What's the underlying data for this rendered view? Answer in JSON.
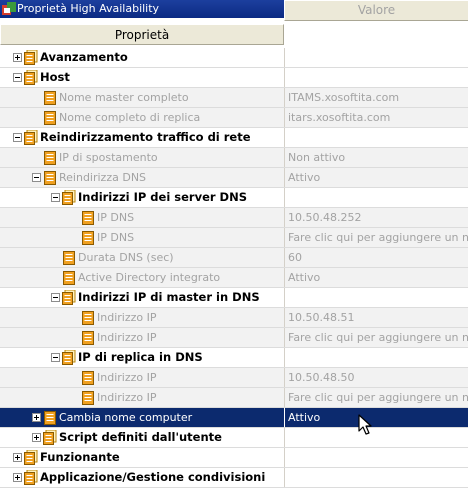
{
  "window": {
    "title": "Proprietà High Availability"
  },
  "columns": {
    "property": "Proprietà",
    "value": "Valore"
  },
  "rows": {
    "avanzamento": {
      "label": "Avanzamento"
    },
    "host": {
      "label": "Host"
    },
    "nome_master": {
      "label": "Nome master completo",
      "value": "ITAMS.xosoftita.com"
    },
    "nome_replica": {
      "label": "Nome completo di replica",
      "value": "itars.xosoftita.com"
    },
    "reindirizzamento": {
      "label": "Reindirizzamento traffico di rete"
    },
    "ip_spostamento": {
      "label": "IP di spostamento",
      "value": "Non attivo"
    },
    "reindirizza_dns": {
      "label": "Reindirizza DNS",
      "value": "Attivo"
    },
    "indirizzi_dns_group": {
      "label": "Indirizzi IP dei server DNS"
    },
    "ip_dns_1": {
      "label": "IP DNS",
      "value": "10.50.48.252"
    },
    "ip_dns_2": {
      "label": "IP DNS",
      "value": "Fare clic qui per aggiungere un n"
    },
    "durata_dns": {
      "label": "Durata DNS (sec)",
      "value": "60"
    },
    "active_directory": {
      "label": "Active Directory integrato",
      "value": "Attivo"
    },
    "master_dns_group": {
      "label": "Indirizzi IP di master in DNS"
    },
    "master_ip_1": {
      "label": "Indirizzo IP",
      "value": "10.50.48.51"
    },
    "master_ip_2": {
      "label": "Indirizzo IP",
      "value": "Fare clic qui per aggiungere un n"
    },
    "replica_dns_group": {
      "label": "IP di replica in DNS"
    },
    "replica_ip_1": {
      "label": "Indirizzo IP",
      "value": "10.50.48.50"
    },
    "replica_ip_2": {
      "label": "Indirizzo IP",
      "value": "Fare clic qui per aggiungere un n"
    },
    "cambia_nome": {
      "label": "Cambia nome computer",
      "value": "Attivo"
    },
    "script_utente": {
      "label": "Script definiti dall'utente"
    },
    "funzionante": {
      "label": "Funzionante"
    },
    "applicazione": {
      "label": "Applicazione/Gestione condivisioni"
    }
  },
  "icons": {
    "group": "folder-doc-icon",
    "item": "property-doc-icon",
    "title": "ha-properties-icon",
    "cursor": "mouse-pointer-icon"
  },
  "colors": {
    "selection": "#0c2a6e",
    "titlebar": "#0b2a83",
    "disabled_text": "#a3a3a3",
    "icon": "#f0a020"
  }
}
